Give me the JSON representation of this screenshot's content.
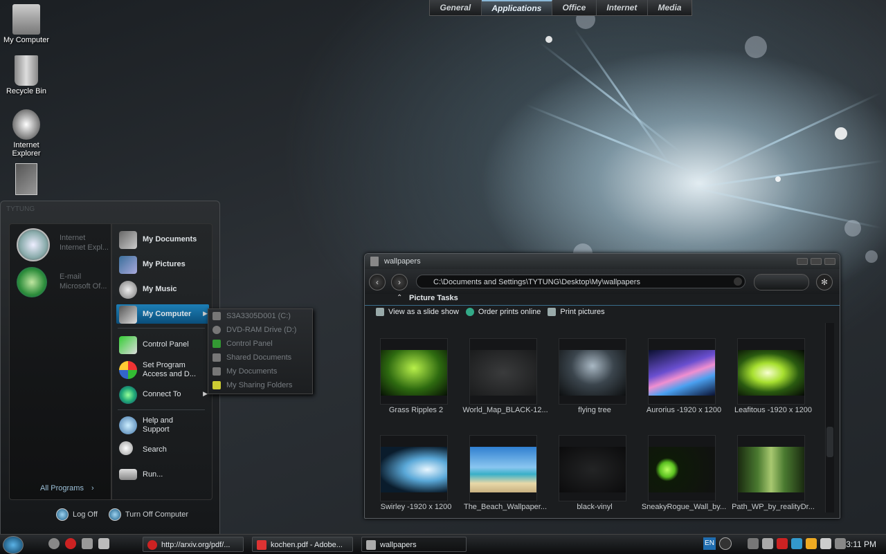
{
  "desktop": {
    "icons": [
      {
        "label": "My Computer"
      },
      {
        "label": "Recycle Bin"
      },
      {
        "label": "Internet Explorer"
      },
      {
        "label": ""
      }
    ]
  },
  "topbar": {
    "tabs": [
      "General",
      "Applications",
      "Office",
      "Internet",
      "Media"
    ],
    "active": "Applications"
  },
  "start_menu": {
    "user": "TYTUNG",
    "pinned": [
      {
        "title": "Internet",
        "subtitle": "Internet Expl...",
        "icon": "clock-icon"
      },
      {
        "title": "E-mail",
        "subtitle": "Microsoft Of...",
        "icon": "email-icon"
      }
    ],
    "all_programs": "All Programs",
    "right_items": [
      {
        "label": "My Documents",
        "icon": "documents-icon"
      },
      {
        "label": "My Pictures",
        "icon": "pictures-icon"
      },
      {
        "label": "My Music",
        "icon": "music-icon"
      },
      {
        "label": "My Computer",
        "icon": "computer-icon"
      },
      {
        "label": "Control Panel",
        "icon": "control-panel-icon"
      },
      {
        "label": "Set Program Access and D...",
        "icon": "set-program-icon"
      },
      {
        "label": "Connect To",
        "icon": "globe-icon"
      },
      {
        "label": "Help and Support",
        "icon": "help-icon"
      },
      {
        "label": "Search",
        "icon": "search-icon"
      },
      {
        "label": "Run...",
        "icon": "run-icon"
      }
    ],
    "logoff": "Log Off",
    "turnoff": "Turn Off Computer"
  },
  "submenu": {
    "items": [
      "S3A3305D001 (C:)",
      "DVD-RAM Drive (D:)",
      "Control Panel",
      "Shared Documents",
      "My Documents",
      "My Sharing Folders"
    ]
  },
  "explorer": {
    "title": "wallpapers",
    "address": "C:\\Documents and Settings\\TYTUNG\\Desktop\\My\\wallpapers",
    "tasks_header": "Picture Tasks",
    "tasks": [
      "View as a slide show",
      "Order prints online",
      "Print pictures"
    ],
    "thumbs": [
      {
        "caption": "Grass Ripples 2"
      },
      {
        "caption": "World_Map_BLACK-12..."
      },
      {
        "caption": "flying tree"
      },
      {
        "caption": "Aurorius -1920 x 1200"
      },
      {
        "caption": "Leafitous -1920 x 1200"
      },
      {
        "caption": "Swirley -1920 x 1200"
      },
      {
        "caption": "The_Beach_Wallpaper..."
      },
      {
        "caption": "black-vinyl"
      },
      {
        "caption": "SneakyRogue_Wall_by..."
      },
      {
        "caption": "Path_WP_by_realityDr..."
      }
    ]
  },
  "taskbar": {
    "buttons": [
      {
        "label": "http://arxiv.org/pdf/...",
        "icon": "opera-icon"
      },
      {
        "label": "kochen.pdf - Adobe...",
        "icon": "pdf-icon"
      },
      {
        "label": "wallpapers",
        "icon": "folder-icon"
      }
    ],
    "lang": "EN",
    "clock": "3:11 PM"
  }
}
